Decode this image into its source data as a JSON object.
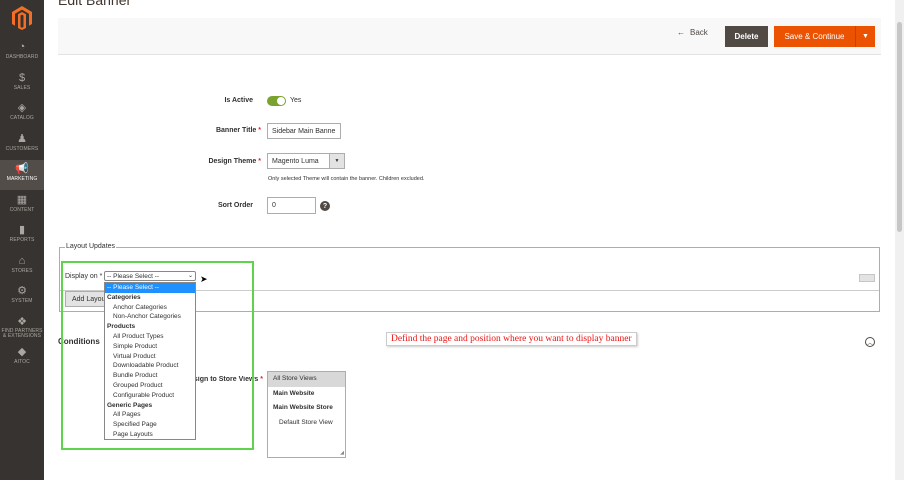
{
  "header": {
    "title": "Edit Banner"
  },
  "sidebar": {
    "items": [
      {
        "label": "Dashboard",
        "icon": "dashboard-icon",
        "glyph": "◔"
      },
      {
        "label": "Sales",
        "icon": "dollar-icon",
        "glyph": "$"
      },
      {
        "label": "Catalog",
        "icon": "cube-icon",
        "glyph": "◈"
      },
      {
        "label": "Customers",
        "icon": "person-icon",
        "glyph": "♟"
      },
      {
        "label": "Marketing",
        "icon": "megaphone-icon",
        "glyph": "📢"
      },
      {
        "label": "Content",
        "icon": "layout-icon",
        "glyph": "▦"
      },
      {
        "label": "Reports",
        "icon": "bar-chart-icon",
        "glyph": "▮"
      },
      {
        "label": "Stores",
        "icon": "store-icon",
        "glyph": "⌂"
      },
      {
        "label": "System",
        "icon": "gear-icon",
        "glyph": "⚙"
      },
      {
        "label": "Find Partners & Extensions",
        "icon": "cubes-icon",
        "glyph": "❖"
      },
      {
        "label": "Aitoc",
        "icon": "aitoc-icon",
        "glyph": "◆"
      }
    ]
  },
  "actions": {
    "back": "Back",
    "back_glyph": "←",
    "delete": "Delete",
    "save": "Save & Continue",
    "split_glyph": "▼"
  },
  "form": {
    "is_active": {
      "label": "Is Active",
      "value": "Yes"
    },
    "banner_title": {
      "label": "Banner Title",
      "value": "Sidebar Main Banne"
    },
    "design_theme": {
      "label": "Design Theme",
      "value": "Magento Luma",
      "note": "Only selected Theme will contain the banner. Children excluded."
    },
    "sort_order": {
      "label": "Sort Order",
      "value": "0",
      "help_glyph": "?"
    },
    "required_mark": "*"
  },
  "layout_updates": {
    "legend": "Layout Updates",
    "display_on_label": "Display on *",
    "select_value": "-- Please Select --",
    "add_button": "Add Layout",
    "dropdown": [
      {
        "label": "-- Please Select --",
        "type": "selected"
      },
      {
        "label": "Categories",
        "type": "group"
      },
      {
        "label": "Anchor Categories",
        "type": "option"
      },
      {
        "label": "Non-Anchor Categories",
        "type": "option"
      },
      {
        "label": "Products",
        "type": "group"
      },
      {
        "label": "All Product Types",
        "type": "option"
      },
      {
        "label": "Simple Product",
        "type": "option"
      },
      {
        "label": "Virtual Product",
        "type": "option"
      },
      {
        "label": "Downloadable Product",
        "type": "option"
      },
      {
        "label": "Bundle Product",
        "type": "option"
      },
      {
        "label": "Grouped Product",
        "type": "option"
      },
      {
        "label": "Configurable Product",
        "type": "option"
      },
      {
        "label": "Generic Pages",
        "type": "group"
      },
      {
        "label": "All Pages",
        "type": "option"
      },
      {
        "label": "Specified Page",
        "type": "option"
      },
      {
        "label": "Page Layouts",
        "type": "option"
      }
    ]
  },
  "conditions": {
    "title": "Conditions",
    "store_label": "Assign to Store Views",
    "stores": [
      {
        "label": "All Store Views",
        "style": "sel"
      },
      {
        "label": "Main Website",
        "style": "bold"
      },
      {
        "label": "Main Website Store",
        "style": "bold"
      },
      {
        "label": "Default Store View",
        "style": "indent"
      }
    ]
  },
  "annotation": "Defind the page and position where you want to display banner",
  "colors": {
    "accent": "#eb5202",
    "sidebar": "#373330",
    "highlight": "#5dd44a",
    "annotation": "#ee1111"
  }
}
